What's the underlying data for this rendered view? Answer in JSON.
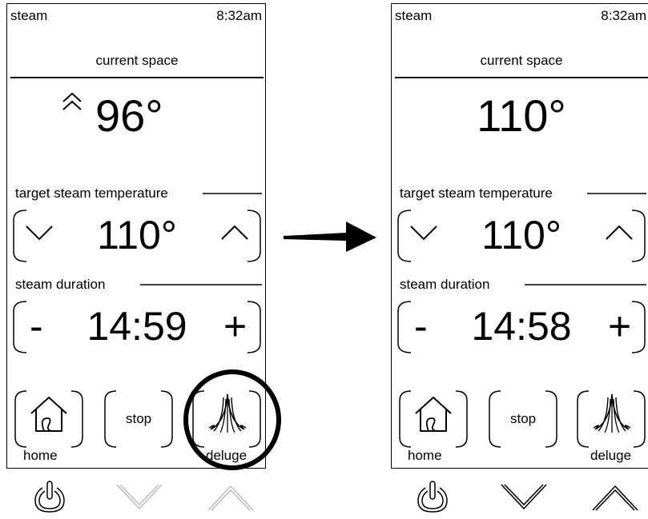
{
  "left_screen": {
    "status_title": "steam",
    "clock": "8:32am",
    "current_label": "current space",
    "current_temp": "96°",
    "target_label": "target steam temperature",
    "target_temp": "110°",
    "duration_label": "steam duration",
    "duration": "14:59",
    "minus": "-",
    "plus": "+",
    "home_label": "home",
    "stop_label": "stop",
    "deluge_label": "deluge"
  },
  "right_screen": {
    "status_title": "steam",
    "clock": "8:32am",
    "current_label": "current space",
    "current_temp": "110°",
    "target_label": "target steam temperature",
    "target_temp": "110°",
    "duration_label": "steam duration",
    "duration": "14:58",
    "minus": "-",
    "plus": "+",
    "home_label": "home",
    "stop_label": "stop",
    "deluge_label": "deluge"
  },
  "highlight": "deluge-button",
  "icons": [
    "power-icon",
    "chevron-down-icon",
    "chevron-up-icon",
    "house-icon",
    "deluge-icon",
    "double-chevron-up-icon"
  ]
}
